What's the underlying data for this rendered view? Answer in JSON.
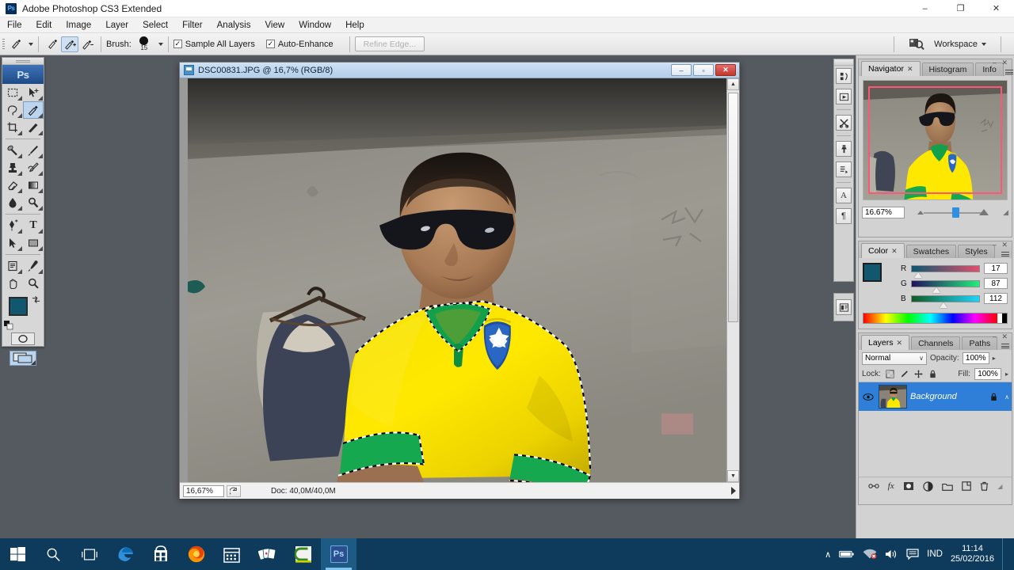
{
  "window": {
    "app_title": "Adobe Photoshop CS3 Extended",
    "logo": "Ps",
    "minimize": "–",
    "maximize": "❐",
    "close": "✕"
  },
  "menubar": {
    "items": [
      "File",
      "Edit",
      "Image",
      "Layer",
      "Select",
      "Filter",
      "Analysis",
      "View",
      "Window",
      "Help"
    ]
  },
  "options_bar": {
    "tool_icon": "quick-selection-tool",
    "mode_new": "new-selection",
    "mode_add": "add-to-selection",
    "mode_subtract": "subtract-from-selection",
    "brush_label": "Brush:",
    "brush_size": "15",
    "sample_all_layers": "Sample All Layers",
    "sample_all_layers_checked": "✓",
    "auto_enhance": "Auto-Enhance",
    "auto_enhance_checked": "✓",
    "refine_edge": "Refine Edge...",
    "workspace": "Workspace"
  },
  "toolbox": {
    "logo": "Ps",
    "tools": [
      {
        "name": "marquee-tool",
        "glyph": "⬚"
      },
      {
        "name": "move-tool",
        "glyph": "✣"
      },
      {
        "name": "lasso-tool",
        "glyph": "➿"
      },
      {
        "name": "quick-selection-tool",
        "glyph": "✐",
        "selected": true
      },
      {
        "name": "crop-tool",
        "glyph": "⌗"
      },
      {
        "name": "slice-tool",
        "glyph": "✄"
      },
      {
        "name": "healing-brush-tool",
        "glyph": "☂"
      },
      {
        "name": "brush-tool",
        "glyph": "✒"
      },
      {
        "name": "clone-stamp-tool",
        "glyph": "⎙"
      },
      {
        "name": "history-brush-tool",
        "glyph": "✇"
      },
      {
        "name": "eraser-tool",
        "glyph": "◧"
      },
      {
        "name": "gradient-tool",
        "glyph": "▤"
      },
      {
        "name": "blur-tool",
        "glyph": "●"
      },
      {
        "name": "dodge-tool",
        "glyph": "◖"
      },
      {
        "name": "pen-tool",
        "glyph": "✑"
      },
      {
        "name": "type-tool",
        "glyph": "T"
      },
      {
        "name": "path-selection-tool",
        "glyph": "➤"
      },
      {
        "name": "rectangle-tool",
        "glyph": "▭"
      },
      {
        "name": "notes-tool",
        "glyph": "☰"
      },
      {
        "name": "eyedropper-tool",
        "glyph": "✒"
      },
      {
        "name": "hand-tool",
        "glyph": "✋"
      },
      {
        "name": "zoom-tool",
        "glyph": "⌕"
      }
    ],
    "foreground_color": "#11576f",
    "background_color": "#cfcfcf",
    "quick_mask": "quick-mask-mode",
    "screen_mode": "screen-mode"
  },
  "document": {
    "title": "DSC00831.JPG @ 16,7% (RGB/8)",
    "minimize": "–",
    "restore": "▫",
    "close": "✕",
    "status_zoom": "16,67%",
    "status_doc": "Doc: 40,0M/40,0M"
  },
  "panels": {
    "navigator": {
      "tabs": [
        {
          "label": "Navigator",
          "active": true,
          "close": "✕"
        },
        {
          "label": "Histogram",
          "active": false
        },
        {
          "label": "Info",
          "active": false
        }
      ],
      "zoom_value": "16.67%",
      "minimize": "–",
      "close": "✕"
    },
    "color": {
      "tabs": [
        {
          "label": "Color",
          "active": true,
          "close": "✕"
        },
        {
          "label": "Swatches",
          "active": false
        },
        {
          "label": "Styles",
          "active": false
        }
      ],
      "foreground_color": "#11576f",
      "background_color": "#cfcfcf",
      "channels": [
        {
          "label": "R",
          "value": "17"
        },
        {
          "label": "G",
          "value": "87"
        },
        {
          "label": "B",
          "value": "112"
        }
      ],
      "minimize": "–",
      "close": "✕"
    },
    "layers": {
      "tabs": [
        {
          "label": "Layers",
          "active": true,
          "close": "✕"
        },
        {
          "label": "Channels",
          "active": false
        },
        {
          "label": "Paths",
          "active": false
        }
      ],
      "blend_mode": "Normal",
      "opacity_label": "Opacity:",
      "opacity_value": "100%",
      "lock_label": "Lock:",
      "lock_icons": [
        "lock-transparent-pixels",
        "lock-image-pixels",
        "lock-position",
        "lock-all"
      ],
      "fill_label": "Fill:",
      "fill_value": "100%",
      "items": [
        {
          "name": "Background",
          "locked": true,
          "visible": true,
          "selected": true
        }
      ],
      "bottom_icons": [
        "link-layers-icon",
        "add-layer-style-icon",
        "add-layer-mask-icon",
        "new-adjustment-layer-icon",
        "new-group-icon",
        "new-layer-icon",
        "delete-layer-icon"
      ],
      "minimize": "–",
      "close": "✕"
    },
    "dock_icons": [
      "brushes-icon",
      "animation-icon",
      "tool-presets-icon",
      "clone-source-icon",
      "actions-icon",
      "character-icon",
      "paragraph-icon",
      "layer-comps-icon"
    ]
  },
  "taskbar": {
    "items": [
      {
        "name": "start-button",
        "label": "start"
      },
      {
        "name": "search-icon",
        "label": "search"
      },
      {
        "name": "task-view-icon",
        "label": "task view"
      },
      {
        "name": "edge-icon",
        "label": "Microsoft Edge"
      },
      {
        "name": "store-icon",
        "label": "Store"
      },
      {
        "name": "firefox-icon",
        "label": "Firefox"
      },
      {
        "name": "calendar-icon",
        "label": "Calendar"
      },
      {
        "name": "solitaire-icon",
        "label": "Solitaire"
      },
      {
        "name": "app-icon",
        "label": "App"
      },
      {
        "name": "photoshop-taskbar-icon",
        "label": "Ps",
        "active": true
      }
    ],
    "tray": {
      "chevron": "∧",
      "battery": "battery-icon",
      "network": "network-icon",
      "volume": "volume-icon",
      "action_center": "action-center-icon",
      "language": "IND",
      "time": "11:14",
      "date": "25/02/2016"
    }
  }
}
